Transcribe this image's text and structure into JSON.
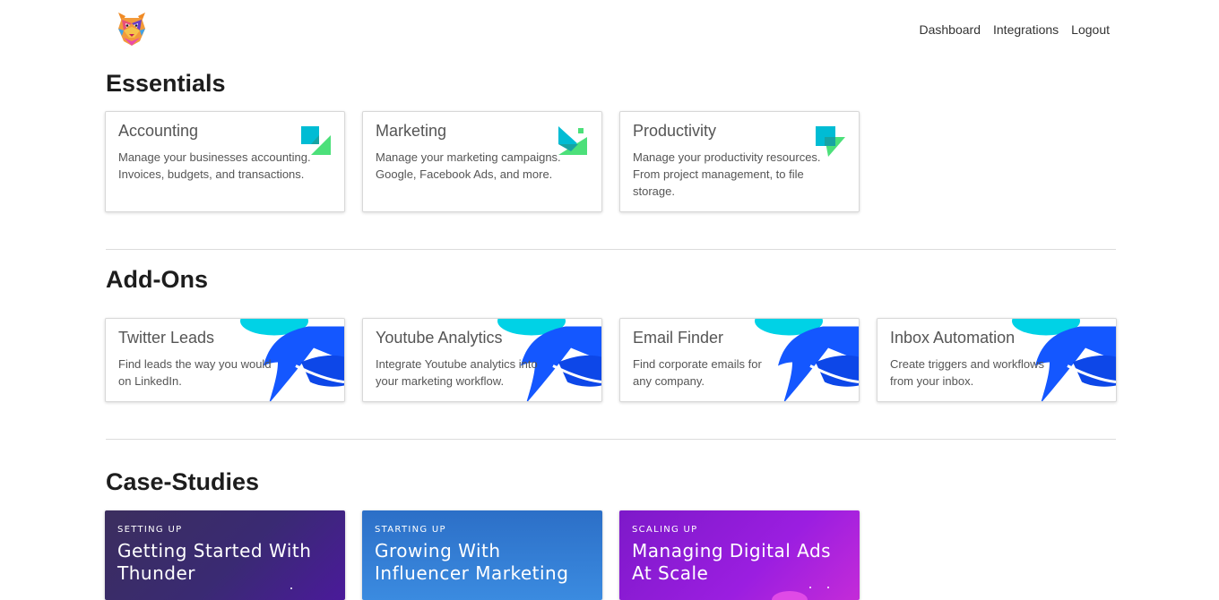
{
  "nav": {
    "items": [
      {
        "label": "Dashboard"
      },
      {
        "label": "Integrations"
      },
      {
        "label": "Logout"
      }
    ]
  },
  "sections": {
    "essentials": {
      "title": "Essentials",
      "cards": [
        {
          "title": "Accounting",
          "desc": "Manage your businesses accounting. Invoices, budgets, and transactions.",
          "icon": "accounting-icon"
        },
        {
          "title": "Marketing",
          "desc": "Manage your marketing campaigns. Google, Facebook Ads, and more.",
          "icon": "marketing-icon"
        },
        {
          "title": "Productivity",
          "desc": "Manage your productivity resources. From project management, to file storage.",
          "icon": "productivity-icon"
        }
      ]
    },
    "addons": {
      "title": "Add-Ons",
      "cards": [
        {
          "title": "Twitter Leads",
          "desc": "Find leads the way you would on LinkedIn."
        },
        {
          "title": "Youtube Analytics",
          "desc": "Integrate Youtube analytics into your marketing workflow."
        },
        {
          "title": "Email Finder",
          "desc": "Find corporate emails for any company."
        },
        {
          "title": "Inbox Automation",
          "desc": "Create triggers and workflows from your inbox."
        }
      ]
    },
    "case_studies": {
      "title": "Case-Studies",
      "cards": [
        {
          "kicker": "SETTING UP",
          "title": "Getting Started With Thunder"
        },
        {
          "kicker": "STARTING UP",
          "title": "Growing With Influencer Marketing"
        },
        {
          "kicker": "SCALING UP",
          "title": "Managing Digital Ads At Scale"
        }
      ]
    }
  },
  "colors": {
    "cyan": "#00bcd4",
    "green": "#4ce07a",
    "blue": "#1565ff",
    "case1": "#3a2a63",
    "case2": "#2f78d0",
    "case3": "#8e1ad6"
  }
}
